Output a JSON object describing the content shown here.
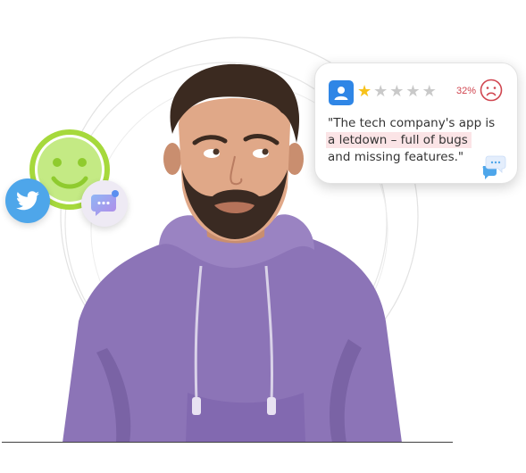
{
  "review": {
    "rating": 1,
    "max_rating": 5,
    "percent": "32%",
    "quote_line1": "\"The tech company's app is",
    "quote_line2": "a letdown – full of bugs",
    "quote_line3": "and missing features.\"",
    "colors": {
      "star_on": "#f7c21b",
      "star_off": "#c9c9c9",
      "negative": "#d0454f",
      "highlight": "#fbe4e6"
    }
  },
  "icons": {
    "smiley": "happy-face-icon",
    "twitter": "twitter-bird-icon",
    "chat": "chat-bubble-icon",
    "sad": "sad-face-icon",
    "avatar": "user-avatar-icon"
  }
}
